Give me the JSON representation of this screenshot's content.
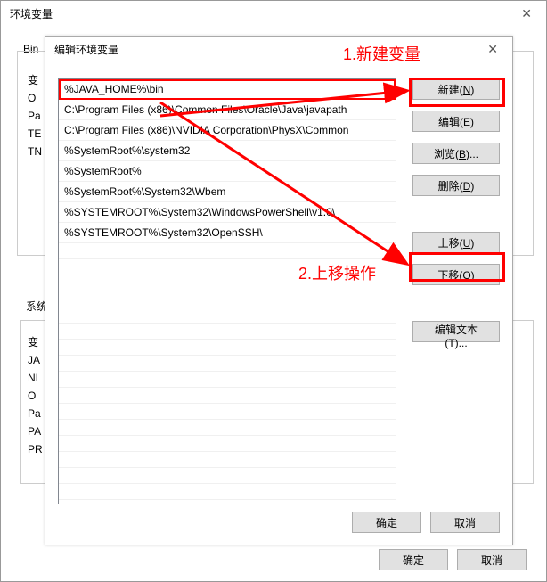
{
  "parent": {
    "title": "环境变量",
    "group1_label": "Bin",
    "group2_label": "系统",
    "hint_lines": [
      "变",
      "O",
      "Pa",
      "TE",
      "TN"
    ],
    "hint2_lines": [
      "变",
      "JA",
      "NI",
      "O",
      "Pa",
      "PA",
      "PR"
    ],
    "ok": "确定",
    "cancel": "取消"
  },
  "child": {
    "title": "编辑环境变量",
    "entries": [
      "%JAVA_HOME%\\bin",
      "C:\\Program Files (x86)\\Common Files\\Oracle\\Java\\javapath",
      "C:\\Program Files (x86)\\NVIDIA Corporation\\PhysX\\Common",
      "%SystemRoot%\\system32",
      "%SystemRoot%",
      "%SystemRoot%\\System32\\Wbem",
      "%SYSTEMROOT%\\System32\\WindowsPowerShell\\v1.0\\",
      "%SYSTEMROOT%\\System32\\OpenSSH\\"
    ],
    "buttons": {
      "new": "新建(N)",
      "edit": "编辑(E)",
      "browse": "浏览(B)...",
      "delete": "删除(D)",
      "up": "上移(U)",
      "down": "下移(O)",
      "edit_text": "编辑文本(T)..."
    },
    "ok": "确定",
    "cancel": "取消"
  },
  "annotations": {
    "step1": "1.新建变量",
    "step2": "2.上移操作"
  }
}
